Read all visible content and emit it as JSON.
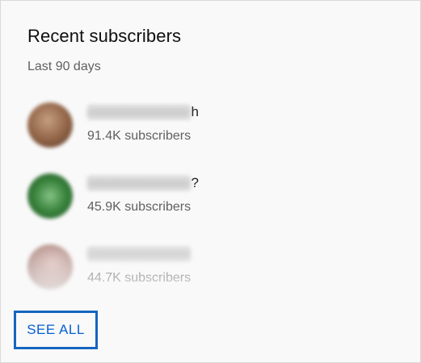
{
  "card": {
    "title": "Recent subscribers",
    "subtitle": "Last 90 days"
  },
  "subscribers": [
    {
      "name_redacted": "xxxxxxxxxxxxxxx",
      "name_visible_tail": "h",
      "count": "91.4K subscribers",
      "avatar_color": "#8a5a3c"
    },
    {
      "name_redacted": "xxxxxxxxxxxxxxx",
      "name_visible_tail": "?",
      "count": "45.9K subscribers",
      "avatar_color": "#2e7d32"
    },
    {
      "name_redacted": "xxxxxxxxxxxxxxx",
      "name_visible_tail": "",
      "count": "44.7K subscribers",
      "avatar_color": "#b08a84"
    }
  ],
  "actions": {
    "see_all_label": "SEE ALL"
  },
  "colors": {
    "accent": "#065fd4",
    "focus_outline": "#1565c0",
    "card_background": "#f9f9f9"
  }
}
